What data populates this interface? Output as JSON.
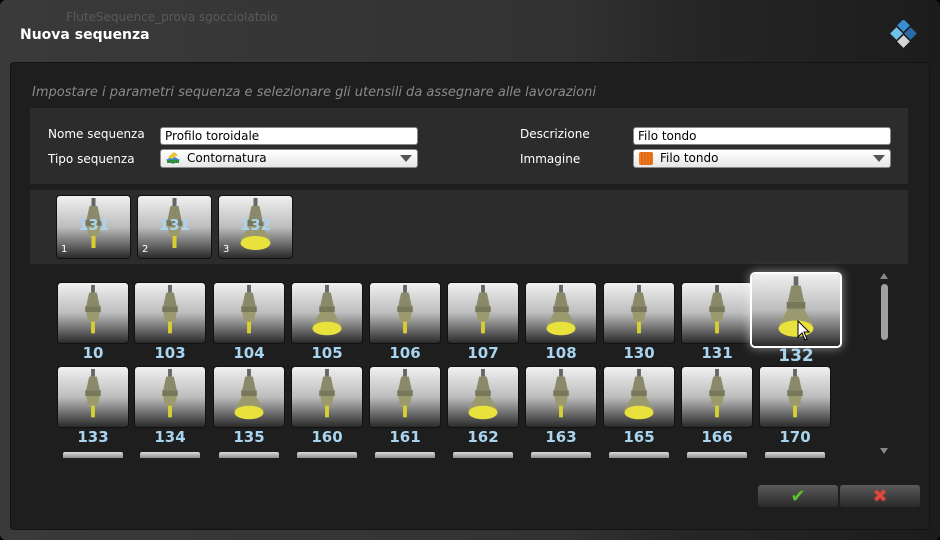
{
  "window": {
    "background_title": "FluteSequence_prova sgocciolatoio",
    "title": "Nuova sequenza"
  },
  "hint": "Impostare i parametri sequenza e selezionare gli utensili da assegnare alle lavorazioni",
  "form": {
    "nome_label": "Nome sequenza",
    "nome_value": "Profilo toroidale",
    "tipo_label": "Tipo sequenza",
    "tipo_value": "Contornatura",
    "descr_label": "Descrizione",
    "descr_value": "Filo tondo",
    "immagine_label": "Immagine",
    "immagine_value": "Filo tondo"
  },
  "sequence": [
    {
      "idx": "1",
      "tool": "131"
    },
    {
      "idx": "2",
      "tool": "131"
    },
    {
      "idx": "3",
      "tool": "132"
    }
  ],
  "tools_row1": [
    "10",
    "103",
    "104",
    "105",
    "106",
    "107",
    "108",
    "130",
    "131",
    "132"
  ],
  "tools_row2": [
    "133",
    "134",
    "135",
    "160",
    "161",
    "162",
    "163",
    "165",
    "166",
    "170"
  ],
  "selected_tool": "132",
  "buttons": {
    "ok": "✔",
    "cancel": "✖"
  },
  "colors": {
    "accent_label": "#a9d4ef",
    "ok": "#5cc12e",
    "cancel": "#e0463b"
  }
}
